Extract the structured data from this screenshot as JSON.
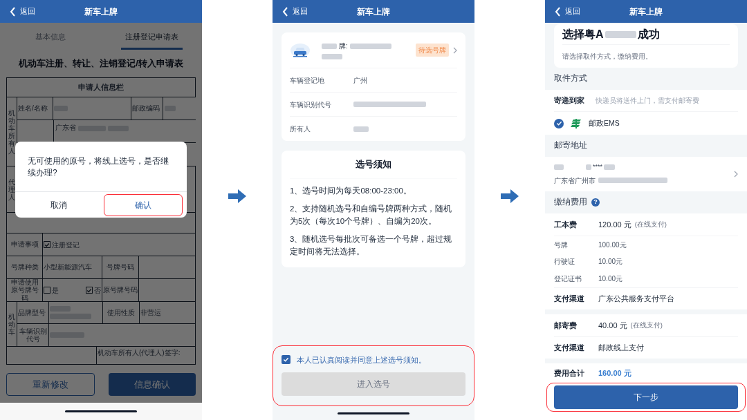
{
  "screens": [
    {
      "kind": "form",
      "header": {
        "back": "返回",
        "title": "新车上牌"
      },
      "tabs": [
        {
          "label": "基本信息",
          "selected": false
        },
        {
          "label": "注册登记申请表",
          "selected": true
        }
      ],
      "form": {
        "title": "机动车注册、转让、注销登记/转入申请表",
        "section": "申请人信息栏",
        "owner_label": "机动车所有人",
        "name_label": "姓名/名称",
        "postcode_label": "邮政编码",
        "address_value": "广东省",
        "agent_label": "代理人",
        "apply_item_label": "申请事项",
        "apply_item": {
          "label": "注册登记",
          "checked": true
        },
        "plate_type_label": "号牌种类",
        "plate_type": "小型新能源汽车",
        "plate_number_label": "号牌号码",
        "reuse_label": "申请使用原号牌号码",
        "reuse_options": [
          {
            "label": "是",
            "checked": false
          },
          {
            "label": "否",
            "checked": true
          }
        ],
        "old_plate_label": "原号牌号码",
        "vehicle_label": "机动车",
        "brand_label": "品牌型号",
        "use_label": "使用性质",
        "use_value": "非营运",
        "vin_label": "车辆识别代号",
        "signature_label": "机动车所有人(代理人)签字:"
      },
      "buttons": [
        {
          "label": "重新修改",
          "kind": "secondary"
        },
        {
          "label": "信息确认",
          "kind": "primary"
        }
      ],
      "dialog": {
        "message": "无可使用的原号，将线上选号，是否继续办理?",
        "buttons": [
          {
            "label": "取消",
            "kind": "cancel",
            "highlighted": false
          },
          {
            "label": "确认",
            "kind": "confirm",
            "highlighted": true
          }
        ]
      }
    },
    {
      "kind": "notice",
      "header": {
        "back": "返回",
        "title": "新车上牌"
      },
      "vehicle": {
        "plate_label": "牌:",
        "status_badge": "待选号牌"
      },
      "details": [
        {
          "label": "车辆登记地",
          "value": "广州"
        },
        {
          "label": "车辆识别代号"
        },
        {
          "label": "所有人"
        }
      ],
      "notice": {
        "title": "选号须知",
        "items": [
          "1、选号时间为每天08:00-23:00。",
          "2、支持随机选号和自编号牌两种方式，随机为5次（每次10个号牌）、自编为20次。",
          "3、随机选号每批次可备选一个号牌，超过规定时间将无法选择。"
        ]
      },
      "agreement": {
        "label": "本人已认真阅读并同意上述选号须知。",
        "checked": true
      },
      "submit": {
        "label": "进入选号",
        "disabled": true
      },
      "bottom_highlighted": true
    },
    {
      "kind": "payment",
      "header": {
        "back": "返回",
        "title": "新车上牌"
      },
      "result": {
        "title_start": "选择粤A",
        "title_end": "成功",
        "subtitle": "请选择取件方式，缴纳费用。"
      },
      "pickup": {
        "heading": "取件方式",
        "method": "寄递到家",
        "method_note": "快递员将送件上门，需支付邮寄费",
        "carriers": [
          {
            "label": "邮政EMS",
            "selected": true
          }
        ]
      },
      "address": {
        "heading": "邮寄地址",
        "line_1_mask": "****",
        "line_2_start": "广东省广州市"
      },
      "fees": {
        "heading": "缴纳费用",
        "help_icon": "?",
        "groups": [
          {
            "rows": [
              {
                "kind": "main",
                "label": "工本费",
                "amount": "120.00 元",
                "note": "(在线支付)"
              },
              {
                "kind": "sub",
                "label": "号牌",
                "amount": "100.00元"
              },
              {
                "kind": "sub",
                "label": "行驶证",
                "amount": "10.00元"
              },
              {
                "kind": "sub",
                "label": "登记证书",
                "amount": "10.00元"
              },
              {
                "kind": "main",
                "label": "支付渠道",
                "amount": "广东公共服务支付平台"
              }
            ]
          },
          {
            "rows": [
              {
                "kind": "main",
                "label": "邮寄费",
                "amount": "40.00 元",
                "note": "(在线支付)"
              },
              {
                "kind": "main",
                "label": "支付渠道",
                "amount": "邮政线上支付"
              }
            ]
          }
        ],
        "total": {
          "label": "费用合计",
          "amount": "160.00 元"
        }
      },
      "next": {
        "label": "下一步",
        "highlighted": true
      }
    }
  ]
}
